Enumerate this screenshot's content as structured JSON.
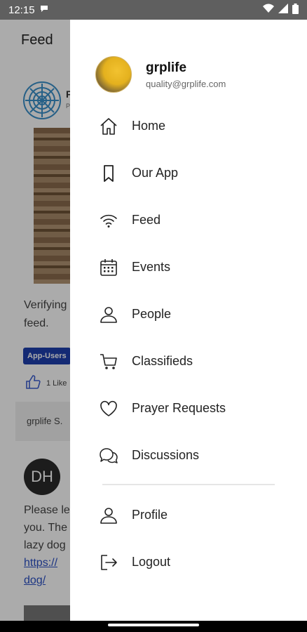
{
  "status": {
    "time": "12:15"
  },
  "feed": {
    "header_title": "Feed",
    "post1_name_snippet": "F",
    "post1_sub_snippet": "P",
    "post1_text": "Verifying feed.",
    "post1_badge": "App-Users",
    "post1_likes": "1 Like",
    "comment_snippet": "grplife S.",
    "post2_avatar_initials": "DH",
    "post2_text_line1": "Please le",
    "post2_text_line2": "you. The",
    "post2_text_line3": "lazy dog",
    "post2_link_line1": "https://",
    "post2_link_line2": "dog/"
  },
  "drawer": {
    "user_name": "grplife",
    "user_email": "quality@grplife.com",
    "menu": [
      {
        "label": "Home",
        "icon": "home-icon"
      },
      {
        "label": "Our App",
        "icon": "bookmark-icon"
      },
      {
        "label": "Feed",
        "icon": "wifi-icon"
      },
      {
        "label": "Events",
        "icon": "calendar-icon"
      },
      {
        "label": "People",
        "icon": "person-icon"
      },
      {
        "label": "Classifieds",
        "icon": "cart-icon"
      },
      {
        "label": "Prayer Requests",
        "icon": "heart-icon"
      },
      {
        "label": "Discussions",
        "icon": "chat-bubbles-icon"
      }
    ],
    "bottom_menu": [
      {
        "label": "Profile",
        "icon": "person-icon"
      },
      {
        "label": "Logout",
        "icon": "logout-icon"
      }
    ]
  }
}
